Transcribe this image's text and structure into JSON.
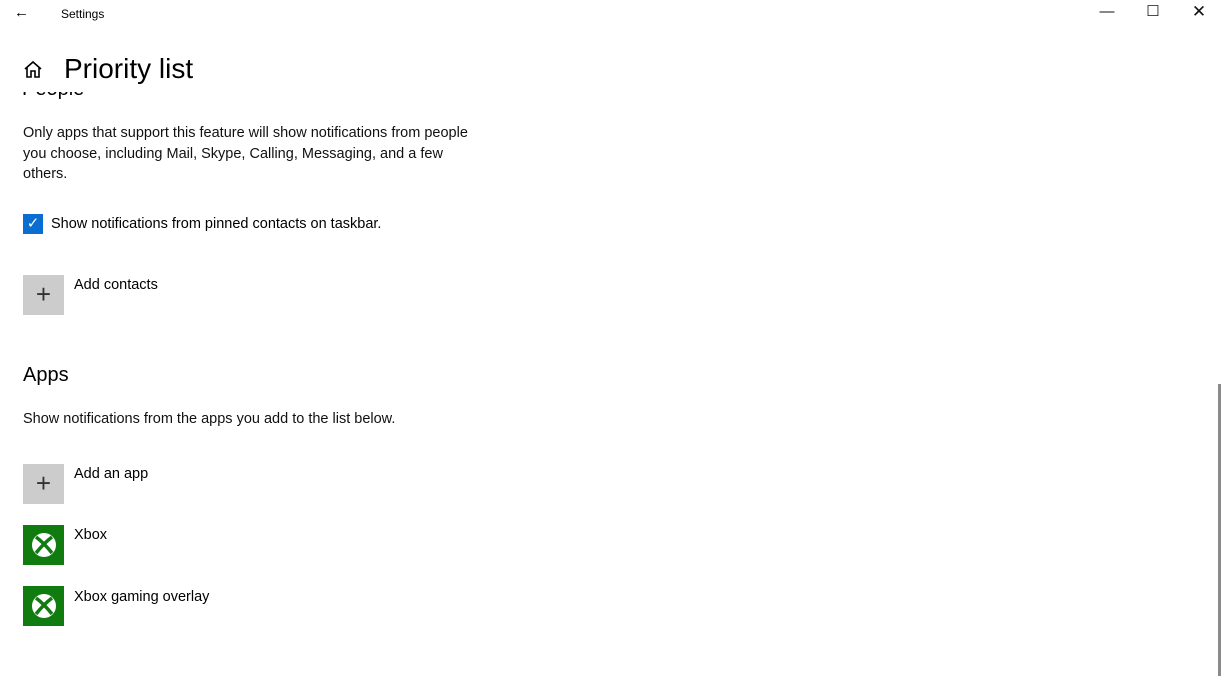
{
  "window": {
    "title": "Settings",
    "back_icon": "arrow-left",
    "minimize_icon": "minimize",
    "maximize_icon": "maximize",
    "close_icon": "close"
  },
  "header": {
    "home_icon": "home",
    "title": "Priority list"
  },
  "people": {
    "heading": "People",
    "description": "Only apps that support this feature will show notifications from people you choose, including Mail, Skype, Calling, Messaging, and a few others.",
    "checkbox": {
      "label": "Show notifications from pinned contacts on taskbar.",
      "checked": true
    },
    "add_label": "Add contacts"
  },
  "apps": {
    "heading": "Apps",
    "description": "Show notifications from the apps you add to the list below.",
    "add_label": "Add an app",
    "items": [
      {
        "name": "Xbox",
        "icon": "xbox"
      },
      {
        "name": "Xbox gaming overlay",
        "icon": "xbox"
      }
    ]
  },
  "colors": {
    "accent": "#0a6ed1",
    "xbox": "#107c10"
  }
}
